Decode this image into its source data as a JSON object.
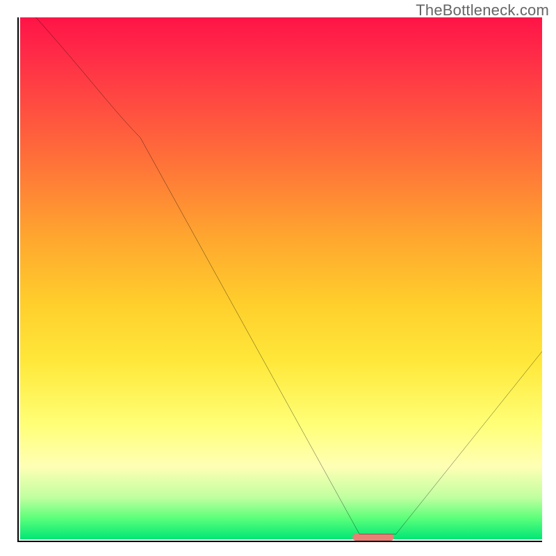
{
  "watermark": "TheBottleneck.com",
  "colors": {
    "axis": "#000000",
    "watermark_text": "#656565",
    "marker": "#e88076",
    "gradient_stops": [
      "#ff1447",
      "#ff2e47",
      "#ff5040",
      "#ff7a37",
      "#ffa62f",
      "#ffcf2c",
      "#ffe83a",
      "#ffff77",
      "#ffffb5",
      "#c0ffa0",
      "#5aff7a",
      "#00e676"
    ]
  },
  "chart_data": {
    "type": "line",
    "title": "",
    "xlabel": "",
    "ylabel": "",
    "xlim": [
      0,
      100
    ],
    "ylim": [
      0,
      100
    ],
    "x": [
      3,
      23,
      65,
      72,
      100
    ],
    "values": [
      100,
      77,
      1,
      1,
      36
    ],
    "marker": {
      "x_start": 65,
      "x_end": 72,
      "y": 0.5
    }
  }
}
